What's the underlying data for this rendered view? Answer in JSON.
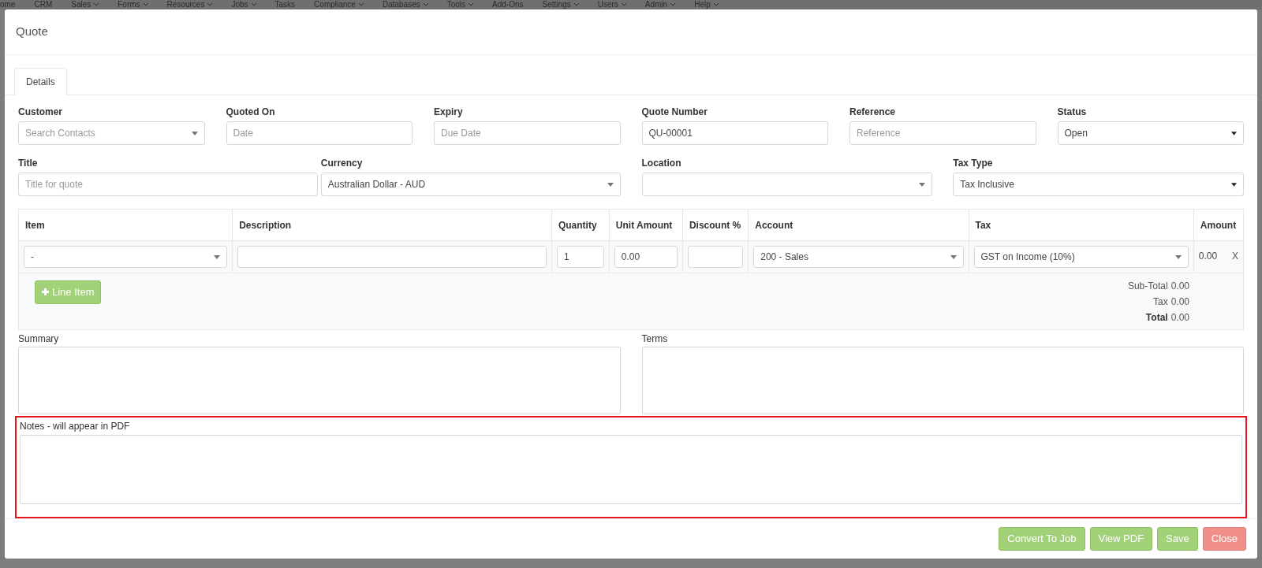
{
  "background_nav": [
    {
      "label": "ome",
      "caret": false
    },
    {
      "label": "CRM",
      "caret": false
    },
    {
      "label": "Sales",
      "caret": true
    },
    {
      "label": "Forms",
      "caret": true
    },
    {
      "label": "Resources",
      "caret": true
    },
    {
      "label": "Jobs",
      "caret": true
    },
    {
      "label": "Tasks",
      "caret": false
    },
    {
      "label": "Compliance",
      "caret": true
    },
    {
      "label": "Databases",
      "caret": true
    },
    {
      "label": "Tools",
      "caret": true
    },
    {
      "label": "Add-Ons",
      "caret": false
    },
    {
      "label": "Settings",
      "caret": true
    },
    {
      "label": "Users",
      "caret": true
    },
    {
      "label": "Admin",
      "caret": true
    },
    {
      "label": "Help",
      "caret": true
    }
  ],
  "modal": {
    "title": "Quote"
  },
  "tabs": [
    {
      "label": "Details",
      "selected": true
    }
  ],
  "row1": [
    {
      "label": "Customer",
      "kind": "select",
      "placeholder": "Search Contacts"
    },
    {
      "label": "Quoted On",
      "kind": "input",
      "placeholder": "Date"
    },
    {
      "label": "Expiry",
      "kind": "input",
      "placeholder": "Due Date"
    },
    {
      "label": "Quote Number",
      "kind": "input",
      "value": "QU-00001"
    },
    {
      "label": "Reference",
      "kind": "input",
      "placeholder": "Reference"
    },
    {
      "label": "Status",
      "kind": "native",
      "value": "Open"
    }
  ],
  "row2": [
    {
      "label": "Title",
      "kind": "input",
      "placeholder": "Title for quote"
    },
    {
      "label": "Currency",
      "kind": "select",
      "value": "Australian Dollar - AUD"
    },
    {
      "label": "Location",
      "kind": "select"
    },
    {
      "label": "Tax Type",
      "kind": "native",
      "value": "Tax Inclusive"
    }
  ],
  "table": {
    "columns": [
      "Item",
      "Description",
      "Quantity",
      "Unit Amount",
      "Discount %",
      "Account",
      "Tax",
      "Amount"
    ],
    "rows": [
      {
        "item": "-",
        "description": "",
        "quantity": "1",
        "unit_amount": "0.00",
        "discount": "",
        "account": "200 - Sales",
        "tax": "GST on Income (10%)",
        "amount": "0.00",
        "remove": "X"
      }
    ],
    "add_button": "Line Item",
    "totals": [
      {
        "label": "Sub-Total",
        "value": "0.00",
        "bold": false
      },
      {
        "label": "Tax",
        "value": "0.00",
        "bold": false
      },
      {
        "label": "Total",
        "value": "0.00",
        "bold": true
      }
    ]
  },
  "summary": {
    "label": "Summary"
  },
  "terms": {
    "label": "Terms"
  },
  "notes": {
    "label": "Notes - will appear in PDF",
    "highlighted": true
  },
  "buttons": [
    {
      "label": "Convert To Job",
      "kind": "success"
    },
    {
      "label": "View PDF",
      "kind": "success"
    },
    {
      "label": "Save",
      "kind": "success"
    },
    {
      "label": "Close",
      "kind": "danger"
    }
  ]
}
